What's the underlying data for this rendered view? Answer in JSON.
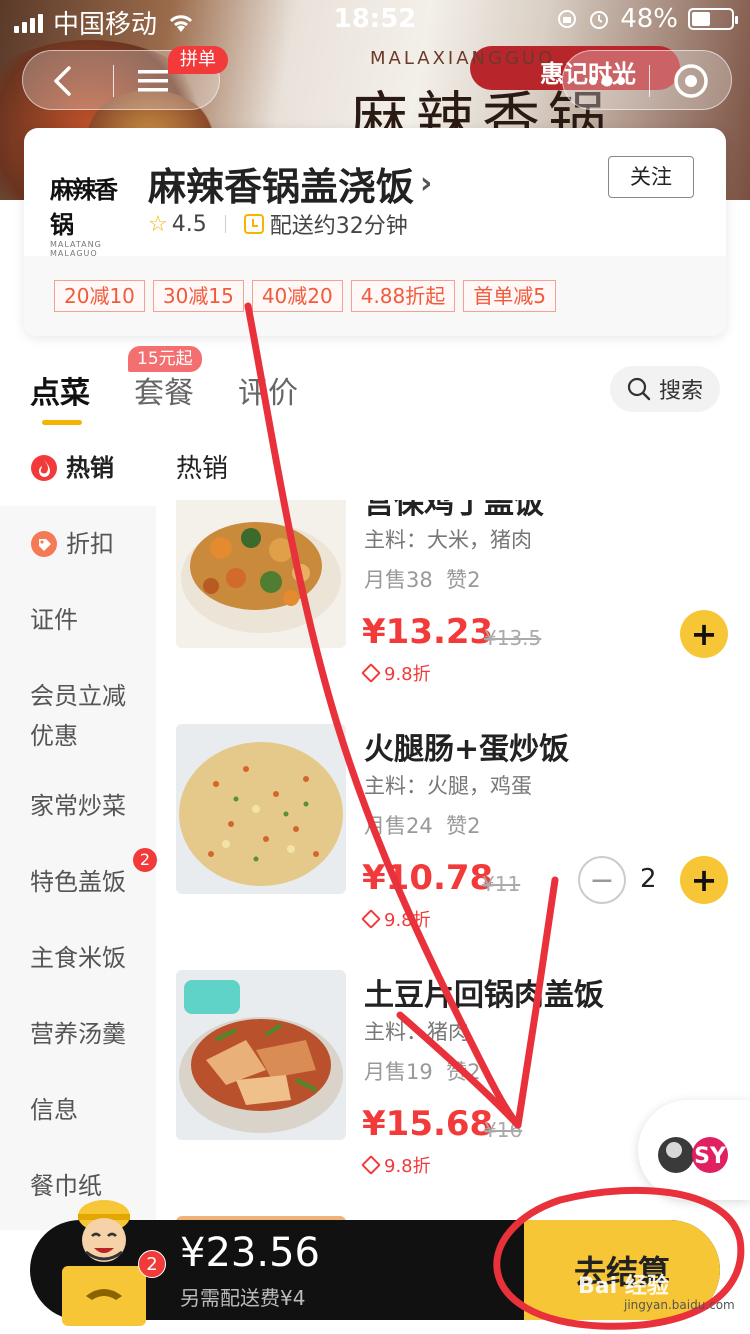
{
  "status_bar": {
    "carrier": "中国移动",
    "time": "18:52",
    "battery": "48%",
    "battery_level": 0.48
  },
  "banner": {
    "title_text": "麻辣香锅",
    "subtitle_text": "MALAXIANGGUO",
    "slogan_text": "惠记时光"
  },
  "nav": {
    "group_badge": "拼单"
  },
  "shop": {
    "logo_text": "麻辣香锅",
    "logo_sub": "MALATANG MALAGUO",
    "name": "麻辣香锅盖浇饭",
    "rating": "4.5",
    "delivery_time": "配送约32分钟",
    "follow_label": "关注",
    "promos": [
      "20减10",
      "30减15",
      "40减20",
      "4.88折起",
      "首单减5"
    ]
  },
  "tabs": {
    "items": [
      "点菜",
      "套餐",
      "评价"
    ],
    "combo_badge": "15元起",
    "search_label": "搜索"
  },
  "sidebar": {
    "items": [
      {
        "label": "热销",
        "badge": ""
      },
      {
        "label": "折扣",
        "badge": ""
      },
      {
        "label": "证件",
        "badge": ""
      },
      {
        "label": "会员立减优惠",
        "badge": ""
      },
      {
        "label": "家常炒菜",
        "badge": ""
      },
      {
        "label": "特色盖饭",
        "badge": "2"
      },
      {
        "label": "主食米饭",
        "badge": ""
      },
      {
        "label": "营养汤羹",
        "badge": ""
      },
      {
        "label": "信息",
        "badge": ""
      },
      {
        "label": "餐巾纸",
        "badge": ""
      }
    ]
  },
  "menu": {
    "section_title": "热销",
    "items": [
      {
        "name": "宫保鸡丁盖饭",
        "ingredients": "主料：大米，猪肉",
        "sales": "月售38",
        "likes": "赞2",
        "price": "¥13.23",
        "original_price": "¥13.5",
        "discount": "9.8折",
        "quantity": ""
      },
      {
        "name": "火腿肠+蛋炒饭",
        "ingredients": "主料：火腿，鸡蛋",
        "sales": "月售24",
        "likes": "赞2",
        "price": "¥10.78",
        "original_price": "¥11",
        "discount": "9.8折",
        "quantity": "2"
      },
      {
        "name": "土豆片回锅肉盖饭",
        "ingredients": "主料：猪肉",
        "sales": "月售19",
        "likes": "赞2",
        "price": "¥15.68",
        "original_price": "¥16",
        "discount": "9.8折",
        "quantity": ""
      }
    ]
  },
  "cart": {
    "total": "¥23.56",
    "fee_note": "另需配送费¥4",
    "count": "2",
    "checkout_label": "去结算"
  },
  "watermark": {
    "text": "Bai 经验",
    "url": "jingyan.baidu.com"
  },
  "colors": {
    "accent": "#f7c636",
    "price_red": "#f23a3a",
    "annotation_red": "#e8313a"
  }
}
